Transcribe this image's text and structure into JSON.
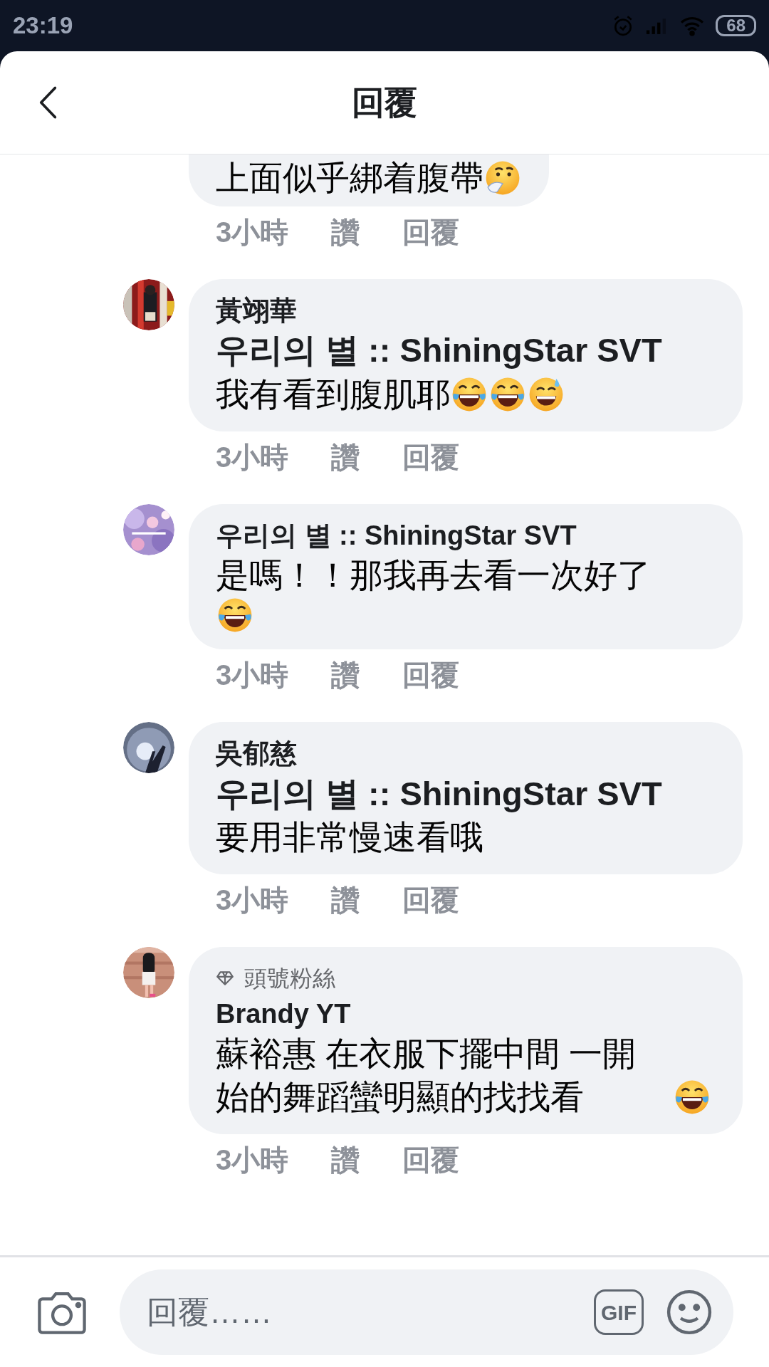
{
  "status_bar": {
    "time": "23:19",
    "battery": "68"
  },
  "header": {
    "title": "回覆"
  },
  "comments": [
    {
      "partial": true,
      "text": "上面似乎綁着腹帶",
      "emojis": [
        {
          "kind": "thinking"
        }
      ],
      "time": "3小時",
      "like": "讚",
      "reply": "回覆"
    },
    {
      "name": "黃翊華",
      "mention": "우리의 별 :: ShiningStar SVT",
      "text": "我有看到腹肌耶",
      "emojis": [
        {
          "kind": "laugh"
        },
        {
          "kind": "laugh"
        },
        {
          "kind": "sweat"
        }
      ],
      "time": "3小時",
      "like": "讚",
      "reply": "回覆"
    },
    {
      "name": "우리의 별 :: ShiningStar SVT",
      "text": "是嗎！！那我再去看一次好了",
      "emojis": [
        {
          "kind": "laugh"
        }
      ],
      "emoji_break": true,
      "time": "3小時",
      "like": "讚",
      "reply": "回覆"
    },
    {
      "name": "吳郁慈",
      "mention": "우리의 별 :: ShiningStar SVT",
      "text": "要用非常慢速看哦",
      "time": "3小時",
      "like": "讚",
      "reply": "回覆"
    },
    {
      "badge": "頭號粉絲",
      "name": "Brandy YT",
      "text": "蘇裕惠 在衣服下擺中間 一開始的舞蹈蠻明顯的找找看",
      "emojis": [
        {
          "kind": "laugh"
        }
      ],
      "time": "3小時",
      "like": "讚",
      "reply": "回覆"
    }
  ],
  "composer": {
    "placeholder": "回覆……",
    "gif": "GIF"
  }
}
